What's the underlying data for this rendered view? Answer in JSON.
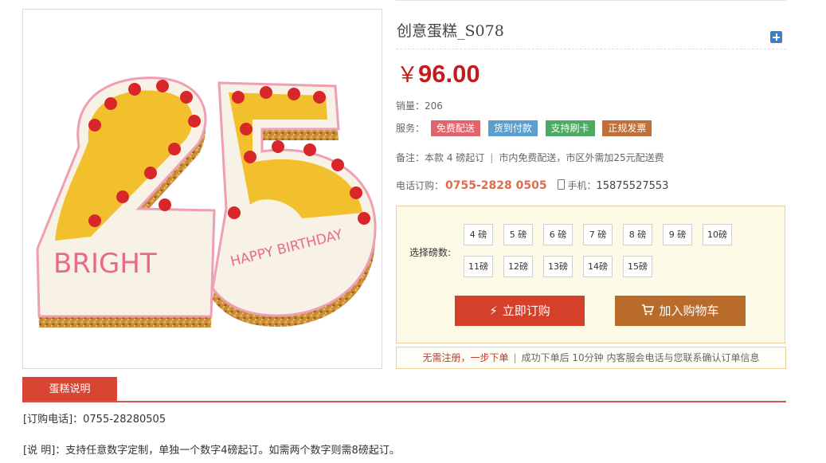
{
  "product": {
    "title": "创意蛋糕_S078",
    "currency": "￥",
    "price": "96.00",
    "image_text": [
      "BRIGHT",
      "HAPPY BIRTHDAY"
    ]
  },
  "sales": {
    "label": "销量：",
    "value": "206"
  },
  "service": {
    "label": "服务：",
    "tags": [
      {
        "text": "免费配送",
        "color": "#e0646c"
      },
      {
        "text": "货到付款",
        "color": "#5a9fcd"
      },
      {
        "text": "支持刷卡",
        "color": "#4caa63"
      },
      {
        "text": "正规发票",
        "color": "#bf6f37"
      }
    ]
  },
  "note": {
    "label": "备注：",
    "part1": "本款 4 磅起订",
    "part2": "市内免费配送，市区外需加25元配送费"
  },
  "phone": {
    "label": "电话订购：",
    "tel": "0755-2828 0505",
    "mobile_label": "手机：",
    "mobile": "15875527553"
  },
  "weights": {
    "label": "选择磅数:",
    "options": [
      "4 磅",
      "5 磅",
      "6 磅",
      "7 磅",
      "8 磅",
      "9 磅",
      "10磅",
      "11磅",
      "12磅",
      "13磅",
      "14磅",
      "15磅"
    ]
  },
  "buttons": {
    "order": "立即订购",
    "cart": "加入购物车"
  },
  "notice": {
    "highlight": "无需注册，一步下单",
    "text": "成功下单后 10分钟 内客服会电话与您联系确认订单信息"
  },
  "tab": {
    "label": "蛋糕说明"
  },
  "details": {
    "order_phone": "[订购电话]：0755-28280505",
    "description": "[说 明]：支持任意数字定制，单独一个数字4磅起订。如需两个数字则需8磅起订。"
  },
  "colors": {
    "accent": "#c01e1e",
    "order_button": "#d5402a",
    "cart_button": "#b96b2c",
    "tab": "#d94433"
  }
}
